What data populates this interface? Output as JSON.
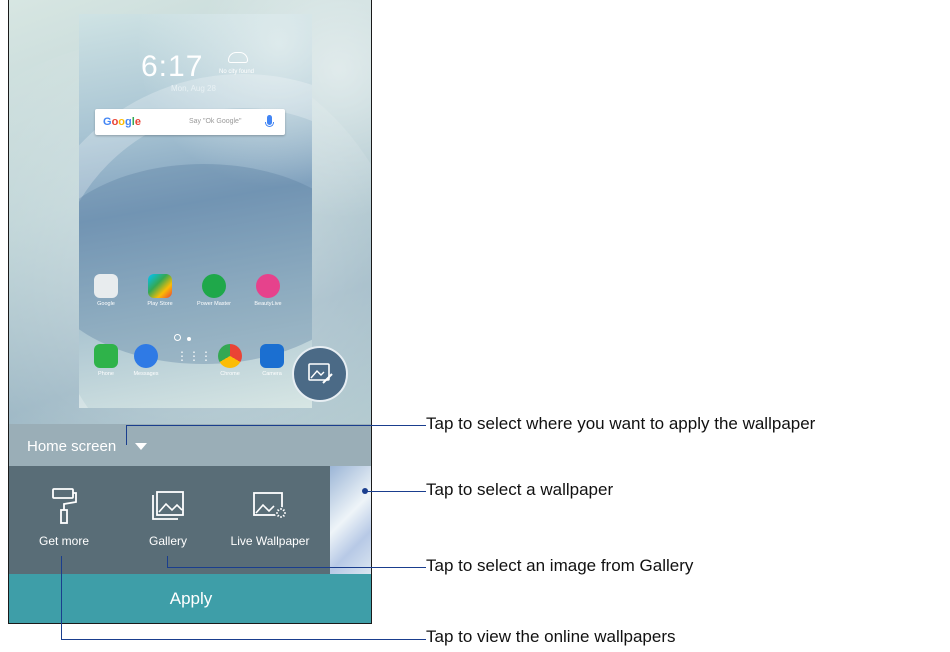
{
  "preview": {
    "time": "6:17",
    "weather": "No city found",
    "date": "Mon, Aug 28",
    "search_hint": "Say \"Ok Google\"",
    "apps_row1": [
      "Google",
      "Play Store",
      "Power Master",
      "BeautyLive"
    ],
    "apps_row2": [
      "Phone",
      "Messages",
      "",
      "Chrome",
      "Camera"
    ]
  },
  "panel": {
    "home_screen_label": "Home screen",
    "get_more_label": "Get more",
    "gallery_label": "Gallery",
    "live_wallpaper_label": "Live Wallpaper",
    "apply_label": "Apply"
  },
  "callouts": {
    "apply_where": "Tap to select where you want to apply the wallpaper",
    "select_wallpaper": "Tap to select a wallpaper",
    "from_gallery": "Tap to select an image from Gallery",
    "online": "Tap to view the online wallpapers"
  },
  "colors": {
    "apply_bar": "#3e9ea8",
    "tools_bar": "#596d77",
    "home_bar": "#9aaeb7",
    "callout_line": "#1a3e8e"
  }
}
